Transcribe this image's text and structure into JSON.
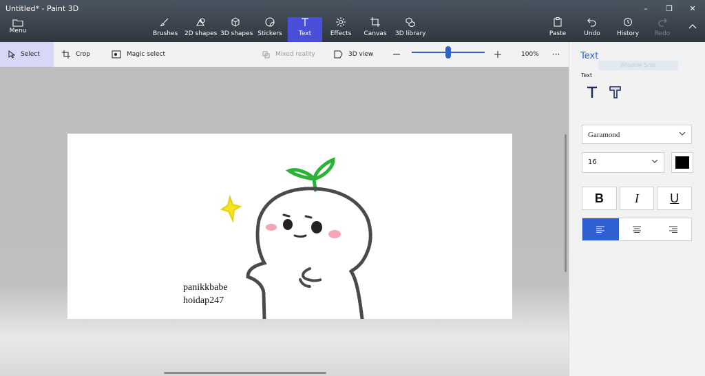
{
  "window": {
    "title": "Untitled* - Paint 3D",
    "minimize": "–",
    "restore": "❐",
    "close": "✕"
  },
  "menu": {
    "label": "Menu",
    "icon": "folder-icon"
  },
  "tools": [
    {
      "label": "Brushes",
      "icon": "brush-icon"
    },
    {
      "label": "2D shapes",
      "icon": "2d-shapes-icon"
    },
    {
      "label": "3D shapes",
      "icon": "3d-shapes-icon"
    },
    {
      "label": "Stickers",
      "icon": "stickers-icon"
    },
    {
      "label": "Text",
      "icon": "text-icon",
      "active": true
    },
    {
      "label": "Effects",
      "icon": "effects-icon"
    },
    {
      "label": "Canvas",
      "icon": "canvas-icon"
    },
    {
      "label": "3D library",
      "icon": "3d-library-icon"
    }
  ],
  "actions": {
    "paste": "Paste",
    "undo": "Undo",
    "history": "History",
    "redo": "Redo"
  },
  "subtoolbar": {
    "select": "Select",
    "crop": "Crop",
    "magic_select": "Magic select",
    "mixed_reality": "Mixed reality",
    "view_3d": "3D view",
    "zoom_percent": "100%",
    "zoom_level": 0.5,
    "more": "···"
  },
  "canvas": {
    "text_content": "panikkbabe\nhoidap247"
  },
  "panel": {
    "title": "Text",
    "ghost_text": "Window Snip",
    "section_label": "Text",
    "font": "Garamond",
    "size": "16",
    "color": "#000000",
    "bold": "B",
    "italic": "I",
    "underline": "U",
    "align_active": "left",
    "accent": "#2f5fd0"
  }
}
